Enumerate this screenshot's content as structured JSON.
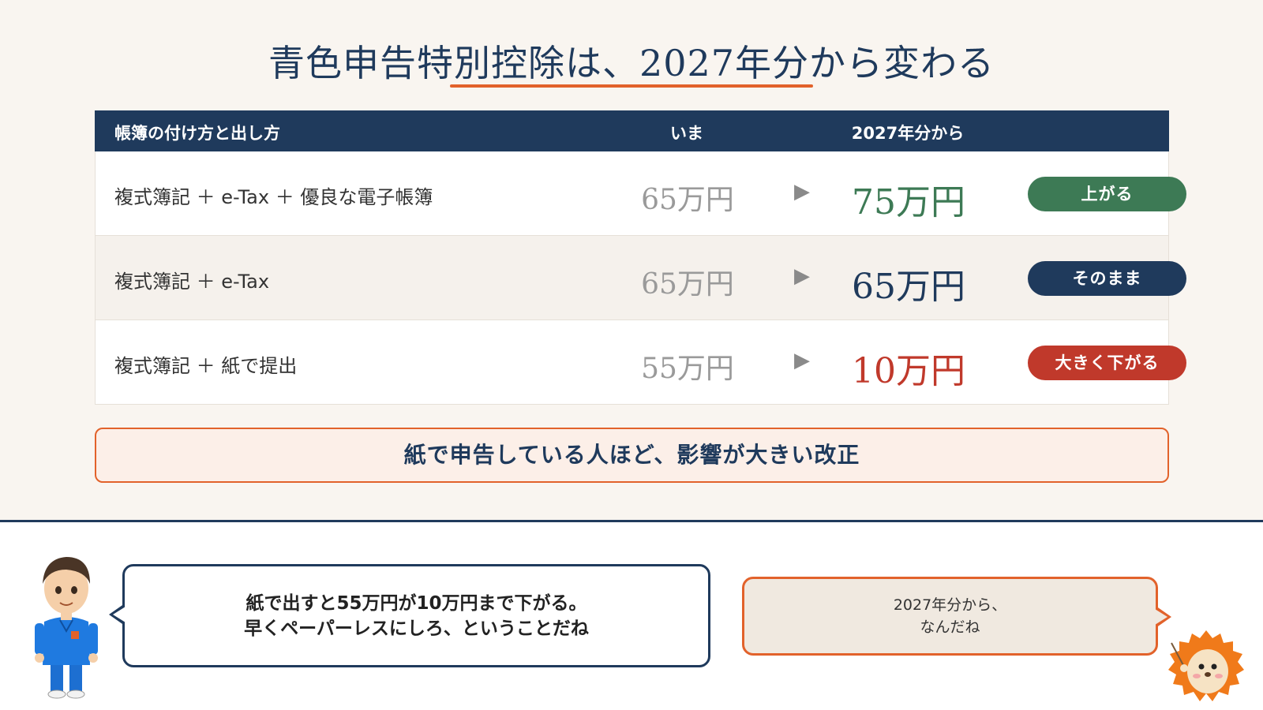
{
  "title": "青色申告特別控除は、2027年分から変わる",
  "table": {
    "headers": {
      "method": "帳簿の付け方と出し方",
      "now": "いま",
      "from2027": "2027年分から"
    },
    "rows": [
      {
        "label": "複式簿記 ＋ e-Tax ＋ 優良な電子帳簿",
        "now": "65万円",
        "arrow": "▶",
        "new": "75万円",
        "badge": "上がる",
        "new_color": "#3d7a55",
        "badge_color": "#3d7a55"
      },
      {
        "label": "複式簿記 ＋ e-Tax",
        "now": "65万円",
        "arrow": "▶",
        "new": "65万円",
        "badge": "そのまま",
        "new_color": "#1f3a5c",
        "badge_color": "#1f3a5c"
      },
      {
        "label": "複式簿記 ＋ 紙で提出",
        "now": "55万円",
        "arrow": "▶",
        "new": "10万円",
        "badge": "大きく下がる",
        "new_color": "#c0392b",
        "badge_color": "#c0392b"
      }
    ]
  },
  "callout": "紙で申告している人ほど、影響が大きい改正",
  "speech_left": {
    "line1": "紙で出すと55万円が10万円まで下がる。",
    "line2": "早くペーパーレスにしろ、ということだね"
  },
  "speech_right": {
    "line1": "2027年分から、",
    "line2": "なんだね"
  },
  "icons": {
    "doctor": "doctor-character-icon",
    "hedgehog": "hedgehog-character-icon"
  },
  "colors": {
    "navy": "#1f3a5c",
    "orange": "#e2622b",
    "green": "#3d7a55",
    "red": "#c0392b"
  }
}
